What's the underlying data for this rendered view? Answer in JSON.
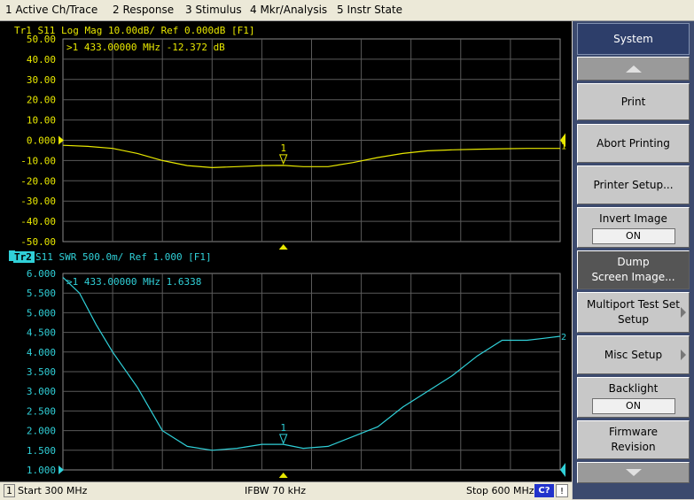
{
  "menu": {
    "items": [
      {
        "label": "1 Active Ch/Trace"
      },
      {
        "label": "2 Response"
      },
      {
        "label": "3 Stimulus"
      },
      {
        "label": "4 Mkr/Analysis"
      },
      {
        "label": "5 Instr State"
      }
    ]
  },
  "trace1": {
    "header": "Tr1  S11  Log Mag  10.00dB/  Ref  0.000dB  [F1]",
    "marker_readout": ">1   433.00000 MHz  -12.372 dB",
    "marker_label": "1",
    "ref_marker_label": "1",
    "y_ticks": [
      "50.00",
      "40.00",
      "30.00",
      "20.00",
      "10.00",
      "0.000",
      "-10.00",
      "-20.00",
      "-30.00",
      "-40.00",
      "-50.00"
    ],
    "color": "#e8e800"
  },
  "trace2": {
    "badge": "Tr2",
    "header": " S11  SWR  500.0m/  Ref  1.000  [F1]",
    "marker_readout": ">1   433.00000 MHz   1.6338",
    "marker_label": "1",
    "ref_marker_label": "2",
    "y_ticks": [
      "6.000",
      "5.500",
      "5.000",
      "4.500",
      "4.000",
      "3.500",
      "3.000",
      "2.500",
      "2.000",
      "1.500",
      "1.000"
    ],
    "color": "#30d0d8"
  },
  "chart_data": [
    {
      "type": "line",
      "title": "Tr1 S11 Log Mag 10.00dB/ Ref 0.000dB [F1]",
      "x_unit": "MHz",
      "xlim": [
        300,
        600
      ],
      "ylim": [
        -50,
        50
      ],
      "grid": true,
      "series": [
        {
          "name": "S11 Log Mag",
          "x": [
            300,
            315,
            330,
            345,
            360,
            375,
            390,
            405,
            420,
            433,
            445,
            460,
            475,
            490,
            505,
            520,
            535,
            550,
            565,
            580,
            600
          ],
          "values": [
            -2.5,
            -3,
            -4,
            -6.5,
            -10,
            -12.5,
            -13.5,
            -13,
            -12.5,
            -12.4,
            -13,
            -13,
            -11,
            -8.5,
            -6.5,
            -5.2,
            -4.7,
            -4.4,
            -4.2,
            -4,
            -4
          ]
        }
      ],
      "markers": [
        {
          "label": "1",
          "x": 433,
          "y": -12.372
        }
      ]
    },
    {
      "type": "line",
      "title": "Tr2 S11 SWR 500.0m/ Ref 1.000 [F1]",
      "x_unit": "MHz",
      "xlim": [
        300,
        600
      ],
      "ylim": [
        1.0,
        6.0
      ],
      "grid": true,
      "series": [
        {
          "name": "S11 SWR",
          "x": [
            300,
            310,
            320,
            330,
            345,
            360,
            375,
            390,
            405,
            420,
            433,
            445,
            460,
            475,
            490,
            505,
            520,
            535,
            550,
            565,
            580,
            590,
            600
          ],
          "values": [
            5.9,
            5.5,
            4.7,
            4.0,
            3.1,
            2.0,
            1.6,
            1.5,
            1.55,
            1.65,
            1.65,
            1.55,
            1.6,
            1.85,
            2.1,
            2.6,
            3.0,
            3.4,
            3.9,
            4.3,
            4.3,
            4.35,
            4.4
          ]
        }
      ],
      "markers": [
        {
          "label": "1",
          "x": 433,
          "y": 1.6338
        }
      ]
    }
  ],
  "status": {
    "channel": "1",
    "start": "Start 300 MHz",
    "ifbw": "IFBW 70 kHz",
    "stop": "Stop 600 MHz",
    "badge": "C?",
    "alert": "!"
  },
  "softkeys": {
    "title": "System",
    "print": "Print",
    "abort": "Abort Printing",
    "printer_setup": "Printer Setup...",
    "invert_label": "Invert Image",
    "invert_value": "ON",
    "dump_line1": "Dump",
    "dump_line2": "Screen Image...",
    "multiport_line1": "Multiport Test Set",
    "multiport_line2": "Setup",
    "misc": "Misc Setup",
    "backlight_label": "Backlight",
    "backlight_value": "ON",
    "firmware_line1": "Firmware",
    "firmware_line2": "Revision"
  }
}
